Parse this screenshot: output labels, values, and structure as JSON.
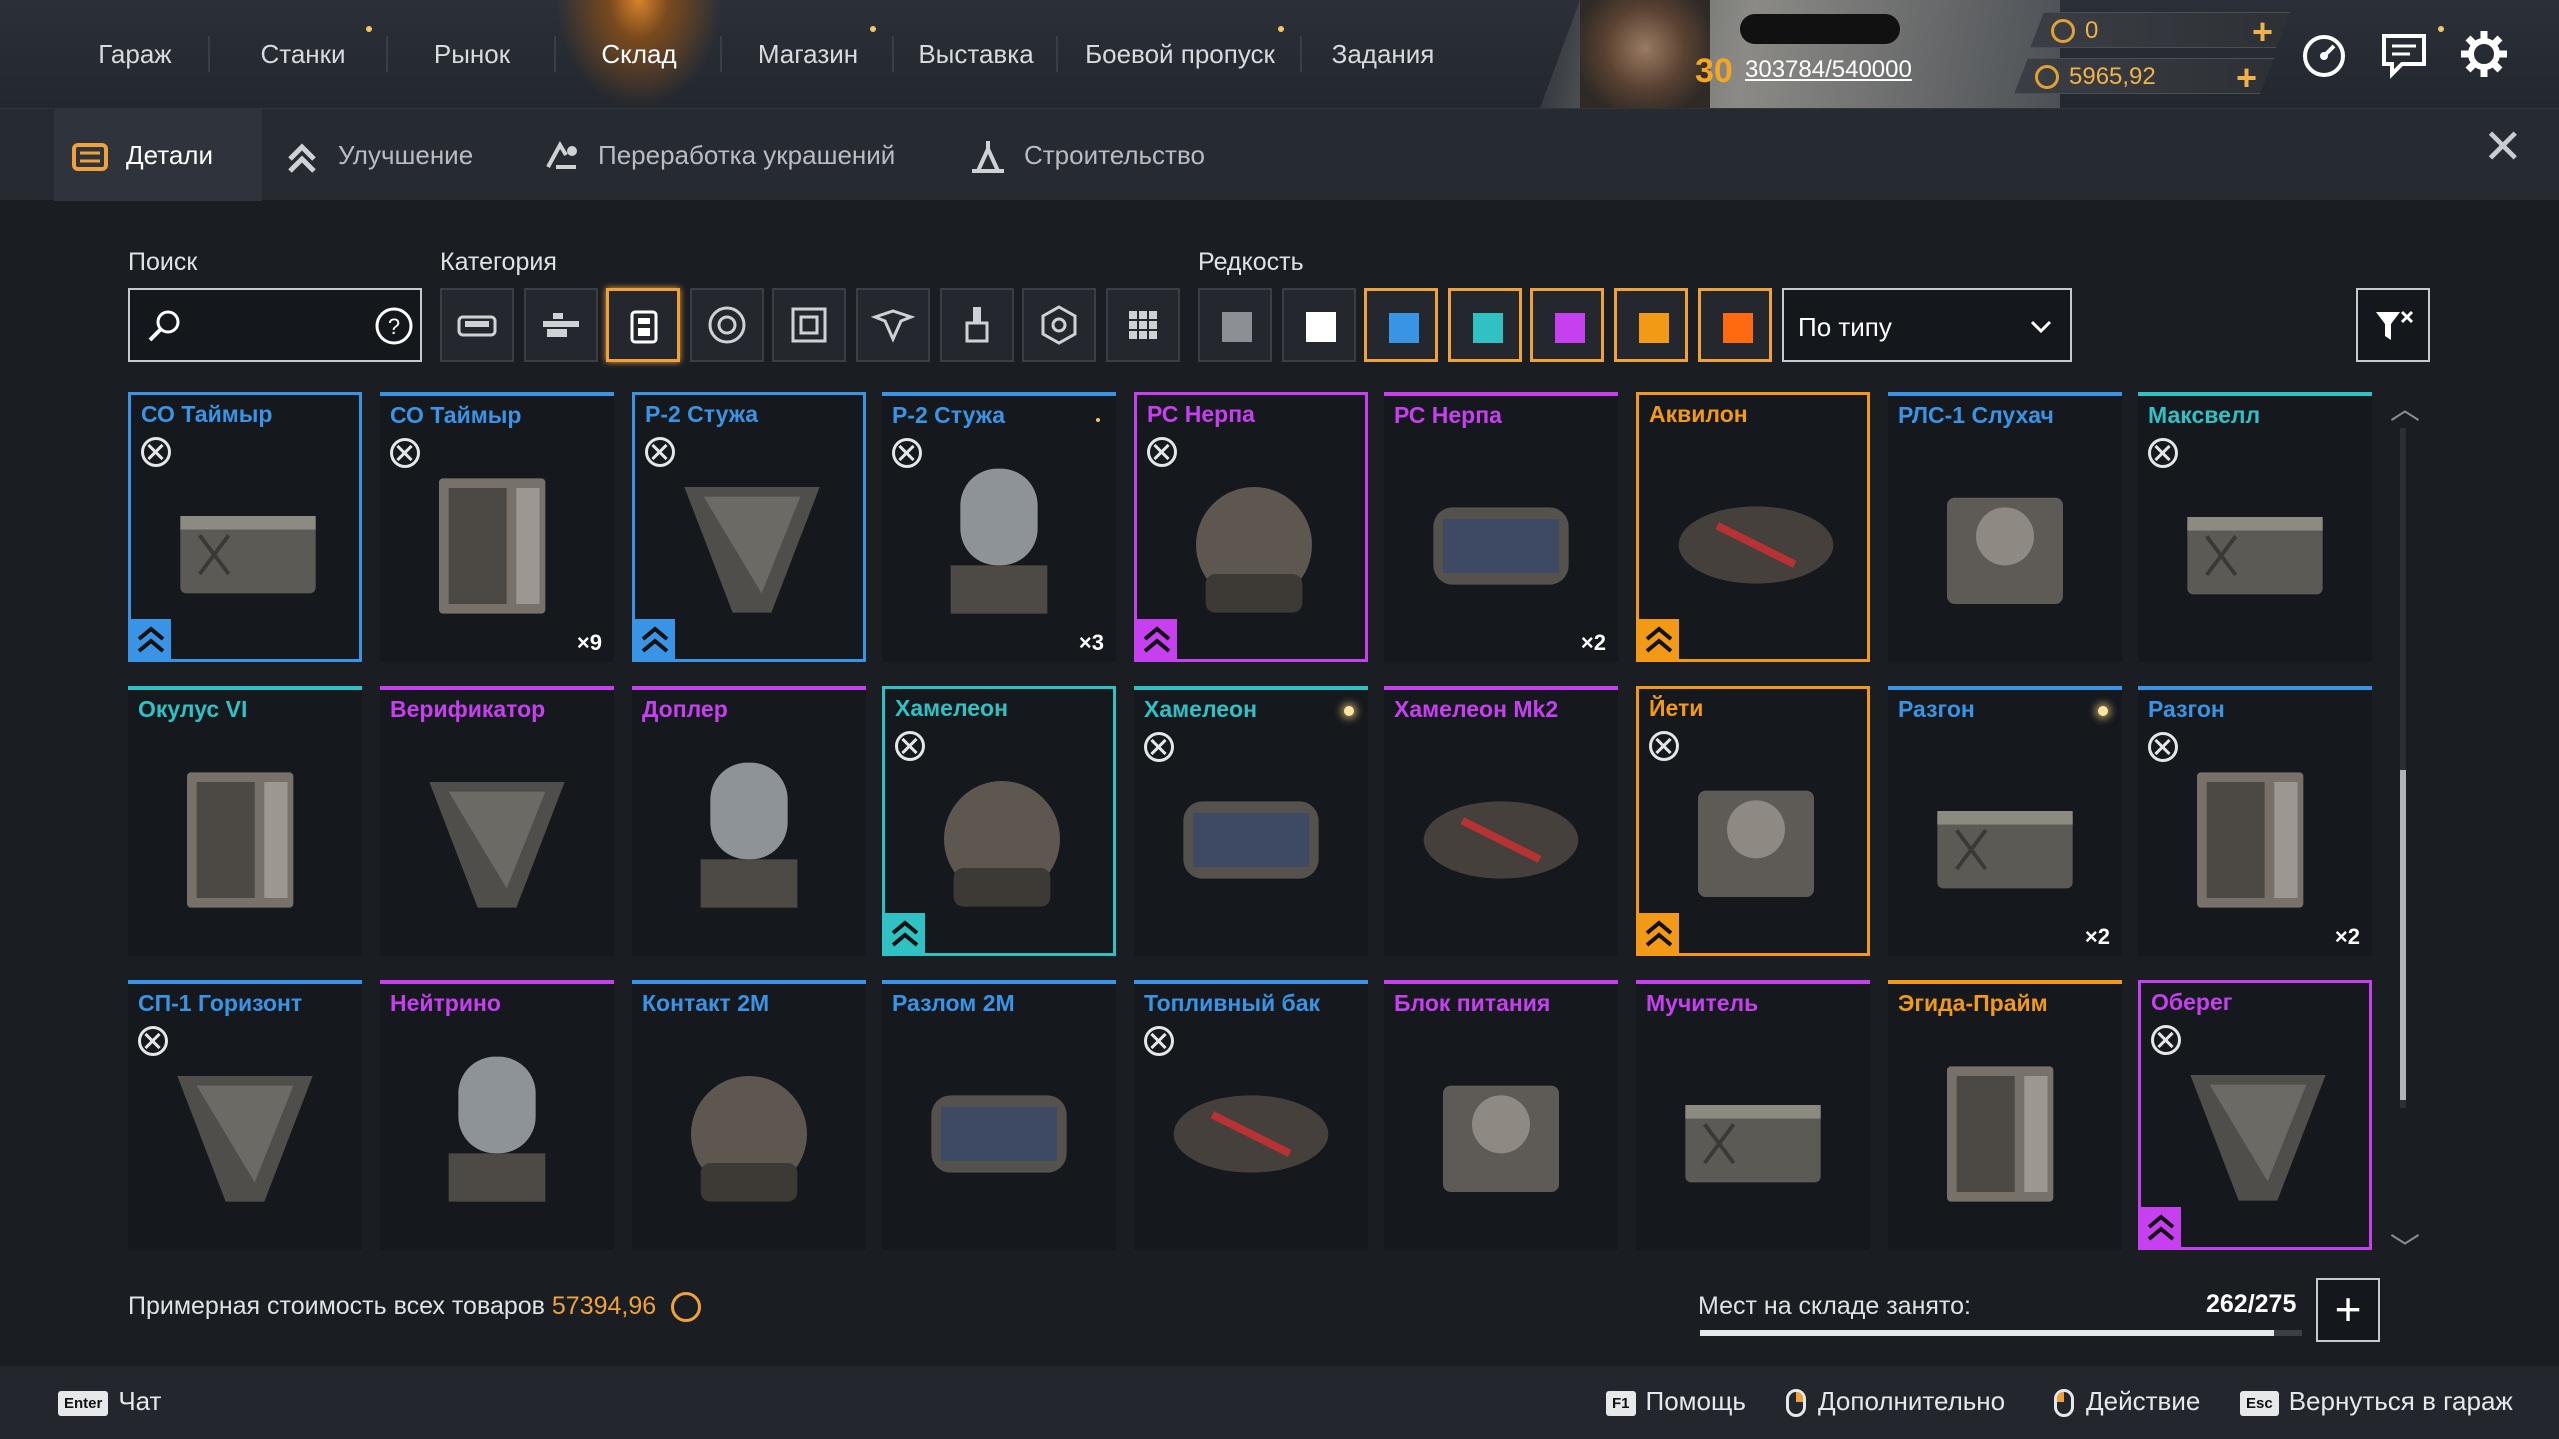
{
  "top_nav": {
    "tabs": [
      {
        "label": "Гараж"
      },
      {
        "label": "Станки"
      },
      {
        "label": "Рынок"
      },
      {
        "label": "Склад",
        "active": true
      },
      {
        "label": "Магазин"
      },
      {
        "label": "Выставка"
      },
      {
        "label": "Боевой пропуск"
      },
      {
        "label": "Задания"
      }
    ]
  },
  "player": {
    "level": "30",
    "xp": "303784/540000"
  },
  "currency": {
    "coupons": "0",
    "coins": "5965,92"
  },
  "sub_tabs": [
    {
      "label": "Детали",
      "icon": "parts-icon",
      "active": true
    },
    {
      "label": "Улучшение",
      "icon": "upgrade-icon"
    },
    {
      "label": "Переработка украшений",
      "icon": "recycle-icon"
    },
    {
      "label": "Строительство",
      "icon": "build-icon"
    }
  ],
  "filters": {
    "search_label": "Поиск",
    "search_placeholder": "",
    "category_label": "Категория",
    "categories": [
      "cabin-icon",
      "weapon-icon",
      "module-icon",
      "wheel-icon",
      "frame-icon",
      "decor-icon",
      "paint-icon",
      "hex-icon",
      "grid-icon"
    ],
    "active_category": 2,
    "rarity_label": "Редкость",
    "rarities": [
      {
        "name": "grey",
        "color": "#8c8f93",
        "selected": false
      },
      {
        "name": "white",
        "color": "#ffffff",
        "selected": false
      },
      {
        "name": "blue",
        "color": "#3a94e6",
        "selected": true
      },
      {
        "name": "teal",
        "color": "#2fc1c4",
        "selected": true
      },
      {
        "name": "purple",
        "color": "#c640f0",
        "selected": true
      },
      {
        "name": "orange",
        "color": "#f29a16",
        "selected": true
      },
      {
        "name": "red-orange",
        "color": "#ff6a10",
        "selected": true
      }
    ],
    "sort_label": "По типу"
  },
  "items": [
    {
      "name": "СО Таймыр",
      "rarity": "#3a94e6",
      "flag": true,
      "count": "",
      "upgrade": true,
      "selected": true
    },
    {
      "name": "СО Таймыр",
      "rarity": "#3a94e6",
      "flag": true,
      "count": "×9",
      "upgrade": false
    },
    {
      "name": "Р-2 Стужа",
      "rarity": "#3a94e6",
      "flag": true,
      "count": "",
      "upgrade": true,
      "selected": true
    },
    {
      "name": "Р-2 Стужа",
      "rarity": "#3a94e6",
      "flag": true,
      "count": "×3",
      "upgrade": false,
      "small_dot": true
    },
    {
      "name": "РС Нерпа",
      "rarity": "#c640f0",
      "flag": true,
      "count": "",
      "upgrade": true,
      "selected": true
    },
    {
      "name": "РС Нерпа",
      "rarity": "#c640f0",
      "flag": false,
      "count": "×2",
      "upgrade": false
    },
    {
      "name": "Аквилон",
      "rarity": "#f29a16",
      "flag": false,
      "count": "",
      "upgrade": true,
      "selected": true
    },
    {
      "name": "РЛС-1 Слухач",
      "rarity": "#3a94e6",
      "flag": false,
      "count": "",
      "upgrade": false
    },
    {
      "name": "Максвелл",
      "rarity": "#2fc1c4",
      "flag": true,
      "count": "",
      "upgrade": false
    },
    {
      "name": "Окулус VI",
      "rarity": "#2fc1c4",
      "flag": false,
      "count": "",
      "upgrade": false
    },
    {
      "name": "Верификатор",
      "rarity": "#c640f0",
      "flag": false,
      "count": "",
      "upgrade": false
    },
    {
      "name": "Доплер",
      "rarity": "#c640f0",
      "flag": false,
      "count": "",
      "upgrade": false
    },
    {
      "name": "Хамелеон",
      "rarity": "#2fc1c4",
      "flag": true,
      "count": "",
      "upgrade": true,
      "selected": true
    },
    {
      "name": "Хамелеон",
      "rarity": "#2fc1c4",
      "flag": true,
      "count": "",
      "upgrade": false,
      "glow_dot": true
    },
    {
      "name": "Хамелеон Mk2",
      "rarity": "#c640f0",
      "flag": false,
      "count": "",
      "upgrade": false
    },
    {
      "name": "Йети",
      "rarity": "#f29a16",
      "flag": true,
      "count": "",
      "upgrade": true,
      "selected": true
    },
    {
      "name": "Разгон",
      "rarity": "#3a94e6",
      "flag": false,
      "count": "×2",
      "upgrade": false,
      "glow_dot": true
    },
    {
      "name": "Разгон",
      "rarity": "#3a94e6",
      "flag": true,
      "count": "×2",
      "upgrade": false
    },
    {
      "name": "СП-1 Горизонт",
      "rarity": "#3a94e6",
      "flag": true,
      "count": "",
      "upgrade": false
    },
    {
      "name": "Нейтрино",
      "rarity": "#c640f0",
      "flag": false,
      "count": "",
      "upgrade": false
    },
    {
      "name": "Контакт 2М",
      "rarity": "#3a94e6",
      "flag": false,
      "count": "",
      "upgrade": false
    },
    {
      "name": "Разлом 2М",
      "rarity": "#3a94e6",
      "flag": false,
      "count": "",
      "upgrade": false
    },
    {
      "name": "Топливный бак",
      "rarity": "#3a94e6",
      "flag": true,
      "count": "",
      "upgrade": false
    },
    {
      "name": "Блок питания",
      "rarity": "#c640f0",
      "flag": false,
      "count": "",
      "upgrade": false
    },
    {
      "name": "Мучитель",
      "rarity": "#c640f0",
      "flag": false,
      "count": "",
      "upgrade": false
    },
    {
      "name": "Эгида-Прайм",
      "rarity": "#f29a16",
      "flag": false,
      "count": "",
      "upgrade": false
    },
    {
      "name": "Оберег",
      "rarity": "#c640f0",
      "flag": true,
      "count": "",
      "upgrade": true,
      "selected": true
    }
  ],
  "footer": {
    "value_label": "Примерная стоимость всех товаров",
    "value": "57394,96",
    "storage_label": "Мест на складе занято:",
    "storage_value": "262/275",
    "storage_fraction": 0.9527
  },
  "hints": [
    {
      "key": "Enter",
      "label": "Чат"
    },
    {
      "key": "F1",
      "label": "Помощь"
    },
    {
      "mouse": "right",
      "label": "Дополнительно"
    },
    {
      "mouse": "left",
      "label": "Действие"
    },
    {
      "key": "Esc",
      "label": "Вернуться в гараж"
    }
  ],
  "colors": {
    "accent": "#f0a23a",
    "background": "#1a1d22"
  }
}
